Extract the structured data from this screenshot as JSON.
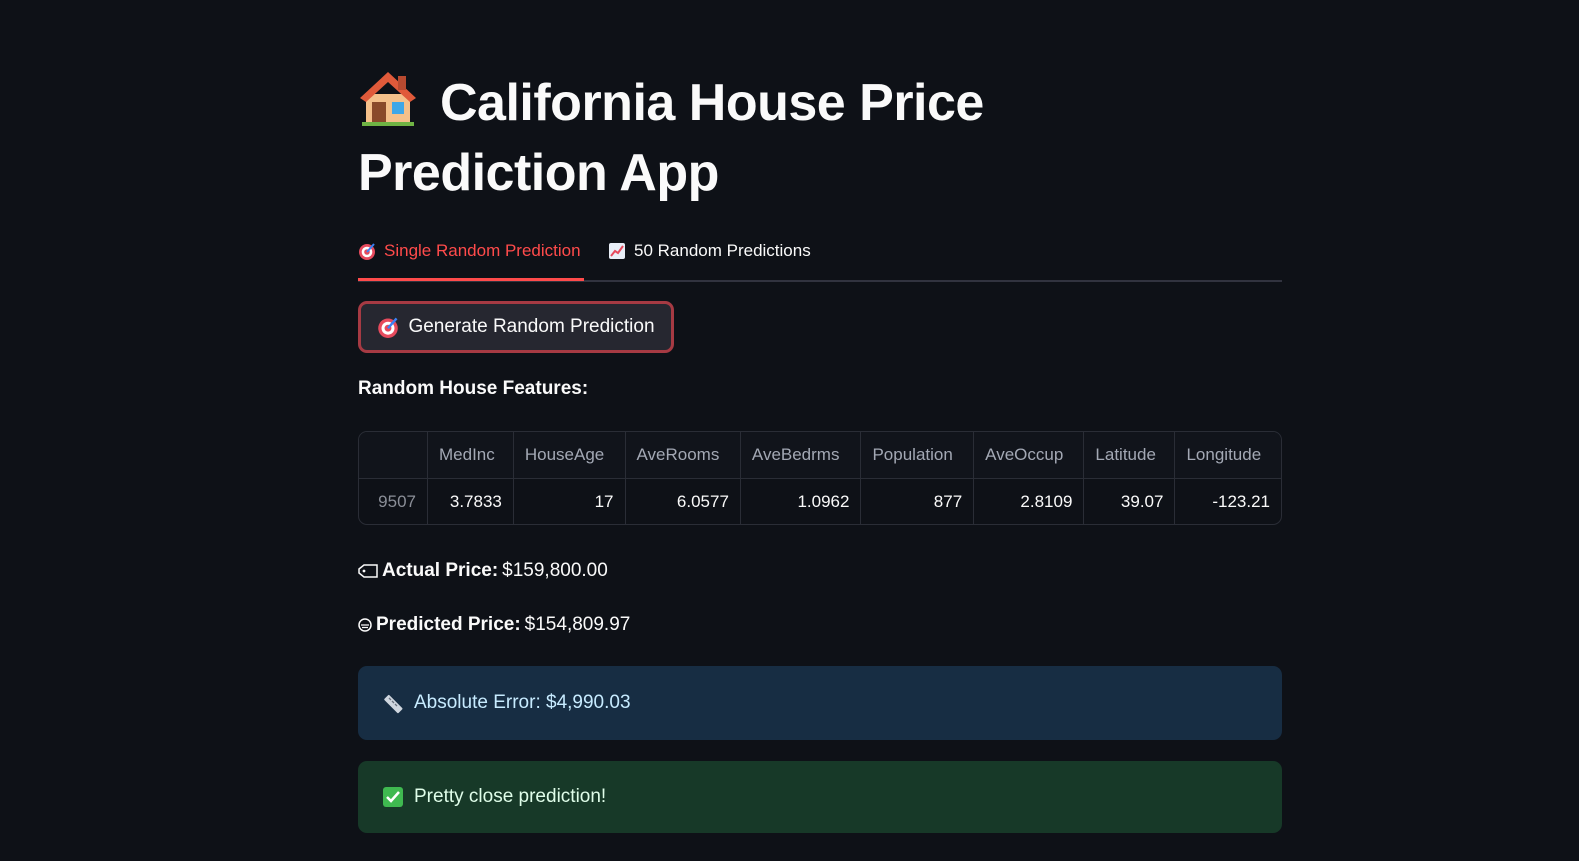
{
  "title": "California House Price Prediction App",
  "tabs": [
    {
      "label": "Single Random Prediction",
      "icon": "target-icon",
      "active": true
    },
    {
      "label": "50 Random Predictions",
      "icon": "chart-icon",
      "active": false
    }
  ],
  "generate_button": "Generate Random Prediction",
  "features_heading": "Random House Features:",
  "table": {
    "columns": [
      "",
      "MedInc",
      "HouseAge",
      "AveRooms",
      "AveBedrms",
      "Population",
      "AveOccup",
      "Latitude",
      "Longitude"
    ],
    "rows": [
      [
        "9507",
        "3.7833",
        "17",
        "6.0577",
        "1.0962",
        "877",
        "2.8109",
        "39.07",
        "-123.21"
      ]
    ]
  },
  "actual": {
    "label": "Actual Price:",
    "value": "$159,800.00"
  },
  "predicted": {
    "label": "Predicted Price:",
    "value": "$154,809.97"
  },
  "error_alert": "Absolute Error: $4,990.03",
  "success_alert": "Pretty close prediction!",
  "colors": {
    "background": "#0e1117",
    "accent": "#ff4b4b",
    "info_bg": "#172d43",
    "success_bg": "#173928"
  }
}
